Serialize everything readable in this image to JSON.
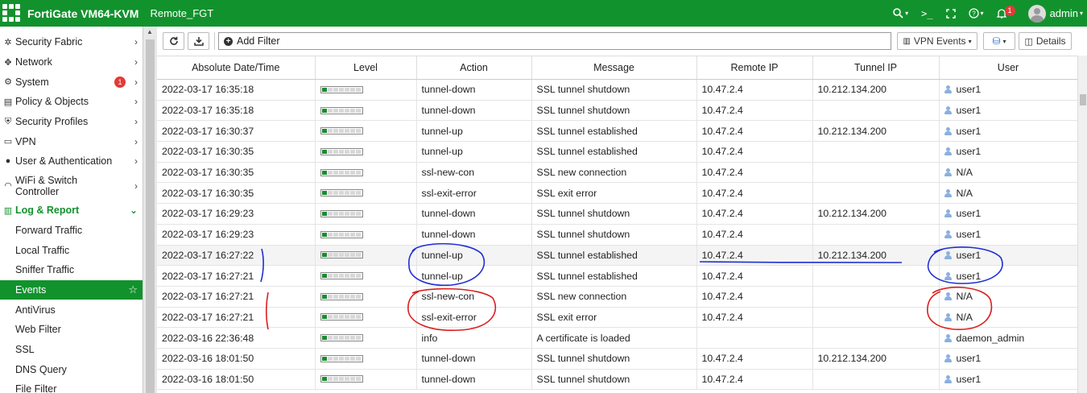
{
  "topbar": {
    "product": "FortiGate VM64-KVM",
    "hostname": "Remote_FGT",
    "notif_count": "1",
    "user": "admin"
  },
  "sidebar": {
    "items": [
      {
        "label": "Security Fabric",
        "icon": "fabric-icon"
      },
      {
        "label": "Network",
        "icon": "network-icon"
      },
      {
        "label": "System",
        "icon": "gear-icon",
        "badge": "1"
      },
      {
        "label": "Policy & Objects",
        "icon": "policy-icon"
      },
      {
        "label": "Security Profiles",
        "icon": "shield-icon"
      },
      {
        "label": "VPN",
        "icon": "monitor-icon"
      },
      {
        "label": "User & Authentication",
        "icon": "user-icon"
      },
      {
        "label": "WiFi & Switch Controller",
        "icon": "wifi-icon"
      }
    ],
    "log_group": "Log & Report",
    "log_subitems": [
      "Forward Traffic",
      "Local Traffic",
      "Sniffer Traffic",
      "Events",
      "AntiVirus",
      "Web Filter",
      "SSL",
      "DNS Query",
      "File Filter"
    ],
    "active": "Events"
  },
  "toolbar": {
    "add_filter": "Add Filter",
    "vpn_events": "VPN Events",
    "details": "Details"
  },
  "table": {
    "columns": [
      "Absolute Date/Time",
      "Level",
      "Action",
      "Message",
      "Remote IP",
      "Tunnel IP",
      "User"
    ],
    "rows": [
      {
        "time": "2022-03-17 16:35:18",
        "level": 1,
        "action": "tunnel-down",
        "message": "SSL tunnel shutdown",
        "remote_ip": "10.47.2.4",
        "tunnel_ip": "10.212.134.200",
        "user": "user1"
      },
      {
        "time": "2022-03-17 16:35:18",
        "level": 1,
        "action": "tunnel-down",
        "message": "SSL tunnel shutdown",
        "remote_ip": "10.47.2.4",
        "tunnel_ip": "",
        "user": "user1"
      },
      {
        "time": "2022-03-17 16:30:37",
        "level": 1,
        "action": "tunnel-up",
        "message": "SSL tunnel established",
        "remote_ip": "10.47.2.4",
        "tunnel_ip": "10.212.134.200",
        "user": "user1"
      },
      {
        "time": "2022-03-17 16:30:35",
        "level": 1,
        "action": "tunnel-up",
        "message": "SSL tunnel established",
        "remote_ip": "10.47.2.4",
        "tunnel_ip": "",
        "user": "user1"
      },
      {
        "time": "2022-03-17 16:30:35",
        "level": 1,
        "action": "ssl-new-con",
        "message": "SSL new connection",
        "remote_ip": "10.47.2.4",
        "tunnel_ip": "",
        "user": "N/A"
      },
      {
        "time": "2022-03-17 16:30:35",
        "level": 1,
        "action": "ssl-exit-error",
        "message": "SSL exit error",
        "remote_ip": "10.47.2.4",
        "tunnel_ip": "",
        "user": "N/A"
      },
      {
        "time": "2022-03-17 16:29:23",
        "level": 1,
        "action": "tunnel-down",
        "message": "SSL tunnel shutdown",
        "remote_ip": "10.47.2.4",
        "tunnel_ip": "10.212.134.200",
        "user": "user1"
      },
      {
        "time": "2022-03-17 16:29:23",
        "level": 1,
        "action": "tunnel-down",
        "message": "SSL tunnel shutdown",
        "remote_ip": "10.47.2.4",
        "tunnel_ip": "",
        "user": "user1"
      },
      {
        "time": "2022-03-17 16:27:22",
        "level": 1,
        "action": "tunnel-up",
        "message": "SSL tunnel established",
        "remote_ip": "10.47.2.4",
        "tunnel_ip": "10.212.134.200",
        "user": "user1"
      },
      {
        "time": "2022-03-17 16:27:21",
        "level": 1,
        "action": "tunnel-up",
        "message": "SSL tunnel established",
        "remote_ip": "10.47.2.4",
        "tunnel_ip": "",
        "user": "user1"
      },
      {
        "time": "2022-03-17 16:27:21",
        "level": 1,
        "action": "ssl-new-con",
        "message": "SSL new connection",
        "remote_ip": "10.47.2.4",
        "tunnel_ip": "",
        "user": "N/A"
      },
      {
        "time": "2022-03-17 16:27:21",
        "level": 1,
        "action": "ssl-exit-error",
        "message": "SSL exit error",
        "remote_ip": "10.47.2.4",
        "tunnel_ip": "",
        "user": "N/A"
      },
      {
        "time": "2022-03-16 22:36:48",
        "level": 1,
        "action": "info",
        "message": "A certificate is loaded",
        "remote_ip": "",
        "tunnel_ip": "",
        "user": "daemon_admin"
      },
      {
        "time": "2022-03-16 18:01:50",
        "level": 1,
        "action": "tunnel-down",
        "message": "SSL tunnel shutdown",
        "remote_ip": "10.47.2.4",
        "tunnel_ip": "10.212.134.200",
        "user": "user1"
      },
      {
        "time": "2022-03-16 18:01:50",
        "level": 1,
        "action": "tunnel-down",
        "message": "SSL tunnel shutdown",
        "remote_ip": "10.47.2.4",
        "tunnel_ip": "",
        "user": "user1"
      }
    ]
  },
  "colors": {
    "brand": "#12922d",
    "annotation_blue": "#1f2ed6",
    "annotation_red": "#d91f1f"
  }
}
